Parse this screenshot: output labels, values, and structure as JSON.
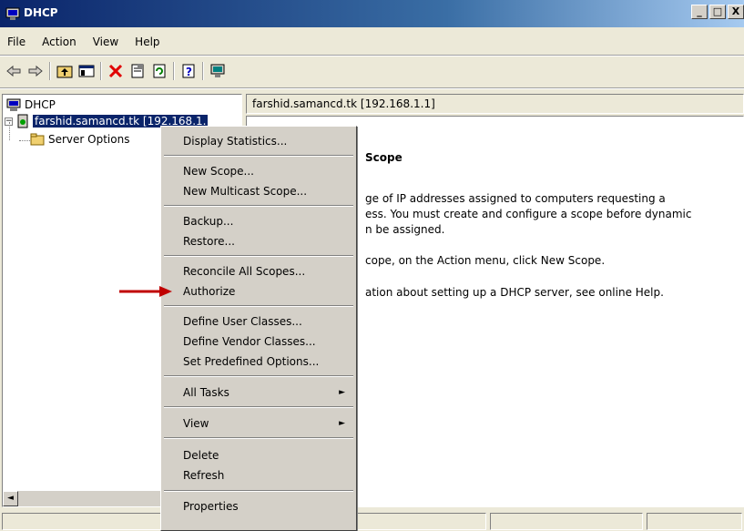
{
  "window": {
    "title": "DHCP",
    "minimize": "_",
    "maximize": "□",
    "close": "X"
  },
  "menubar": {
    "file": "File",
    "action": "Action",
    "view": "View",
    "help": "Help"
  },
  "toolbar": {
    "icons": [
      "back-icon",
      "forward-icon",
      "up-folder-icon",
      "show-hide-tree-icon",
      "delete-icon",
      "properties-icon",
      "refresh-icon",
      "help-icon",
      "computer-icon"
    ]
  },
  "tree": {
    "root": "DHCP",
    "server": "farshid.samancd.tk [192.168.1.",
    "server_options": "Server Options"
  },
  "right": {
    "header": "farshid.samancd.tk [192.168.1.1]",
    "heading": "Scope",
    "line1": "ge of IP addresses assigned to computers requesting a",
    "line2": "ess. You must create and configure a scope before dynamic",
    "line3": "n be assigned.",
    "line4": "cope, on the Action menu, click New Scope.",
    "line5": "ation about setting up a DHCP server, see online Help."
  },
  "context_menu": {
    "display_statistics": "Display Statistics...",
    "new_scope": "New Scope...",
    "new_multicast_scope": "New Multicast Scope...",
    "backup": "Backup...",
    "restore": "Restore...",
    "reconcile_all_scopes": "Reconcile All Scopes...",
    "authorize": "Authorize",
    "define_user_classes": "Define User Classes...",
    "define_vendor_classes": "Define Vendor Classes...",
    "set_predefined_options": "Set Predefined Options...",
    "all_tasks": "All Tasks",
    "view": "View",
    "delete": "Delete",
    "refresh": "Refresh",
    "properties": "Properties"
  },
  "colors": {
    "title_bar": "#0a246a",
    "selection": "#0a246a",
    "arrow": "#c00000",
    "face": "#d4d0c8"
  }
}
